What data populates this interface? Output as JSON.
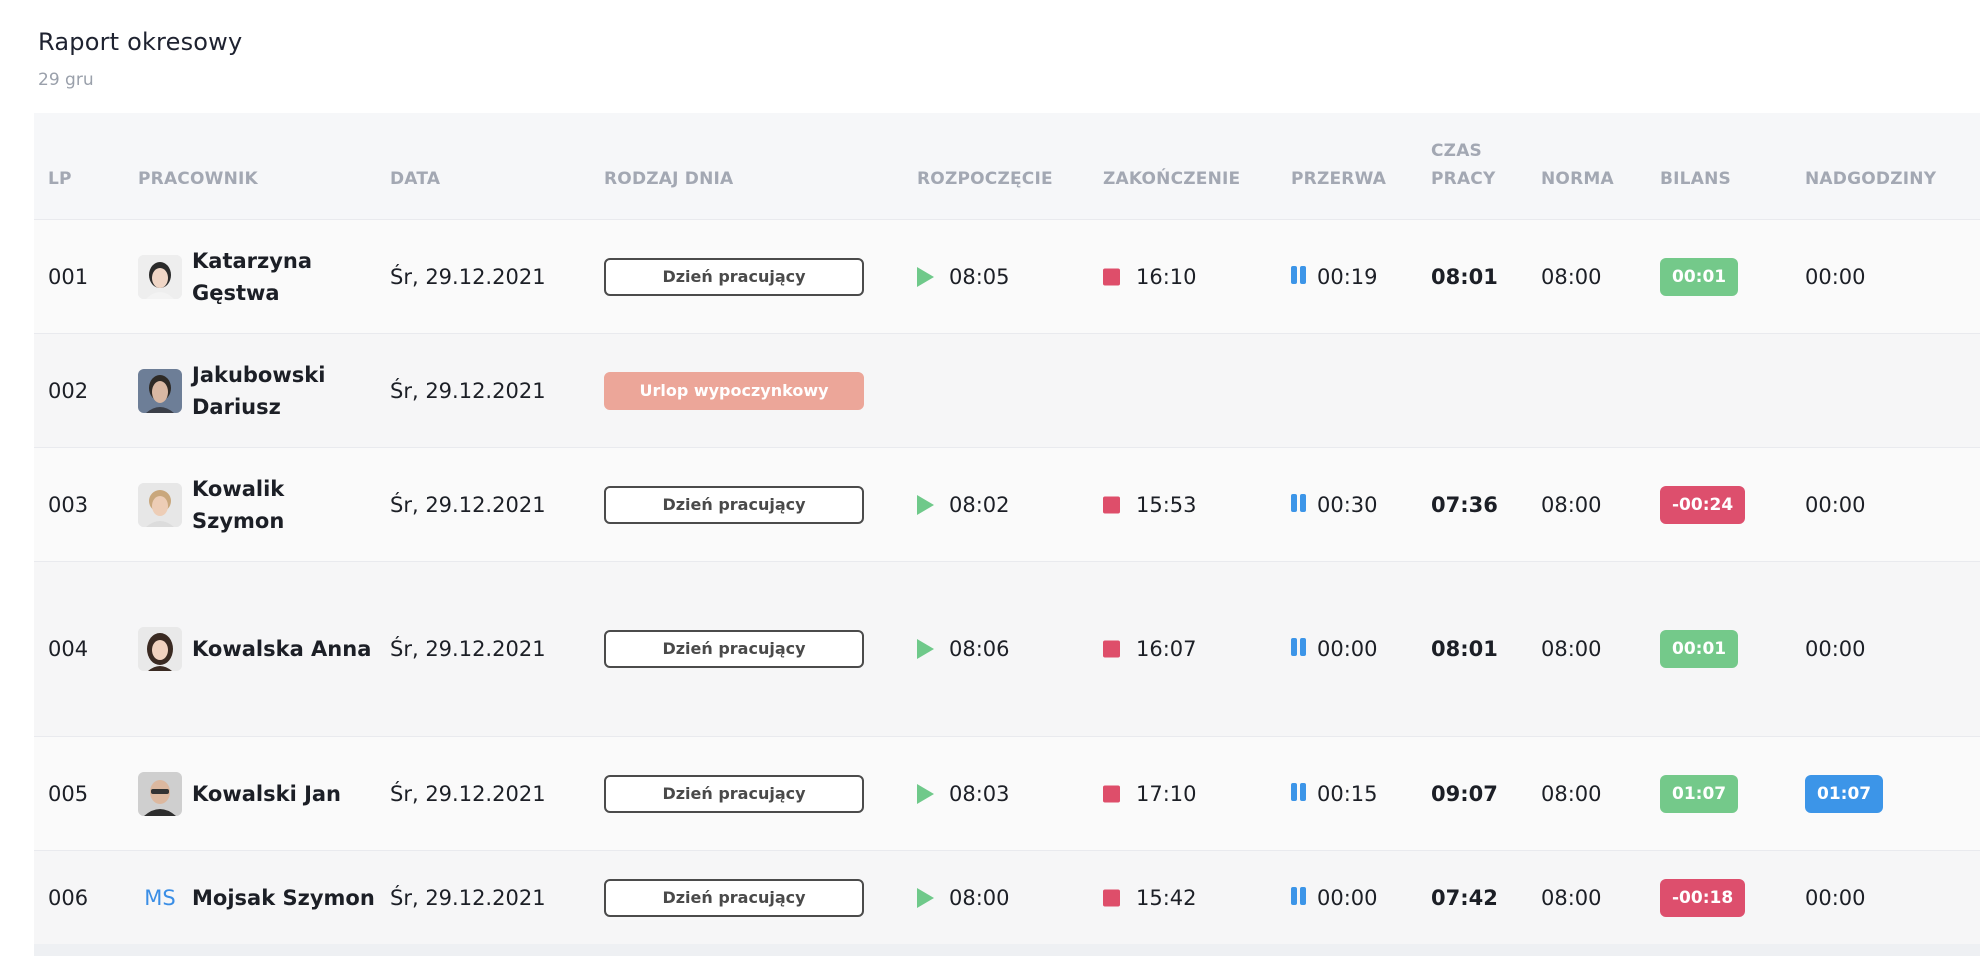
{
  "report": {
    "title": "Raport okresowy",
    "date": "29 gru"
  },
  "columns": {
    "lp": "LP",
    "employee": "PRACOWNIK",
    "date": "DATA",
    "day_type": "RODZAJ DNIA",
    "start": "ROZPOCZĘCIE",
    "end": "ZAKOŃCZENIE",
    "break": "PRZERWA",
    "work_time_1": "CZAS",
    "work_time_2": "PRACY",
    "norm": "NORMA",
    "balance": "BILANS",
    "overtime": "NADGODZINY"
  },
  "rows": [
    {
      "lp": "001",
      "first": "Katarzyna",
      "last": "Gęstwa",
      "date": "Śr, 29.12.2021",
      "day_type": "Dzień pracujący",
      "start": "08:05",
      "end": "16:10",
      "break": "00:19",
      "work": "08:01",
      "norm": "08:00",
      "balance": "00:01",
      "overtime": "00:00"
    },
    {
      "lp": "002",
      "first": "Jakubowski",
      "last": "Dariusz",
      "date": "Śr, 29.12.2021",
      "day_type": "Urlop wypoczynkowy"
    },
    {
      "lp": "003",
      "first": "Kowalik",
      "last": "Szymon",
      "date": "Śr, 29.12.2021",
      "day_type": "Dzień pracujący",
      "start": "08:02",
      "end": "15:53",
      "break": "00:30",
      "work": "07:36",
      "norm": "08:00",
      "balance": "-00:24",
      "overtime": "00:00"
    },
    {
      "lp": "004",
      "name": "Kowalska Anna",
      "date": "Śr, 29.12.2021",
      "day_type": "Dzień pracujący",
      "start": "08:06",
      "end": "16:07",
      "break": "00:00",
      "work": "08:01",
      "norm": "08:00",
      "balance": "00:01",
      "overtime": "00:00"
    },
    {
      "lp": "005",
      "name": "Kowalski Jan",
      "date": "Śr, 29.12.2021",
      "day_type": "Dzień pracujący",
      "start": "08:03",
      "end": "17:10",
      "break": "00:15",
      "work": "09:07",
      "norm": "08:00",
      "balance": "01:07",
      "overtime": "01:07"
    },
    {
      "lp": "006",
      "initials": "MS",
      "name": "Mojsak Szymon",
      "date": "Śr, 29.12.2021",
      "day_type": "Dzień pracujący",
      "start": "08:00",
      "end": "15:42",
      "break": "00:00",
      "work": "07:42",
      "norm": "08:00",
      "balance": "-00:18",
      "overtime": "00:00"
    }
  ],
  "icons": {
    "start": "play-icon",
    "end": "stop-icon",
    "break": "pause-icon"
  },
  "colors": {
    "positive": "#74c98a",
    "negative": "#dd4f6d",
    "overtime": "#3c95e8",
    "leave": "#eca699"
  }
}
